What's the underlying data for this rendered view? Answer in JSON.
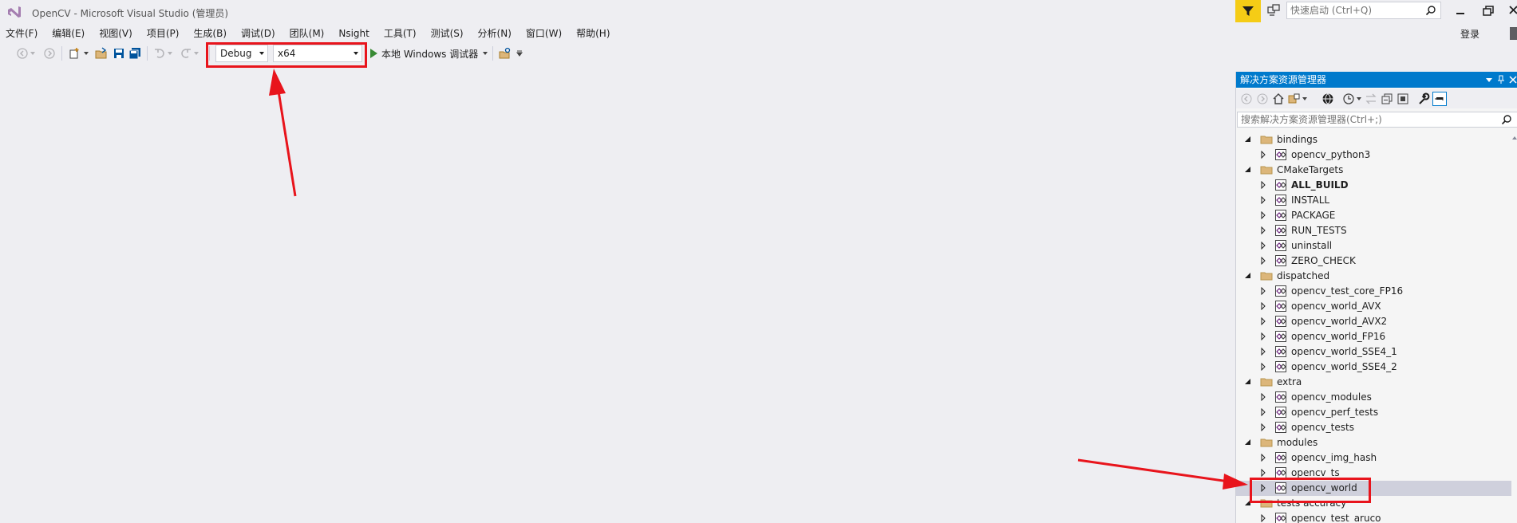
{
  "window": {
    "title": "OpenCV - Microsoft Visual Studio (管理员)",
    "quick_launch_placeholder": "快速启动 (Ctrl+Q)",
    "login_label": "登录"
  },
  "menu": {
    "items": [
      {
        "label": "文件(F)"
      },
      {
        "label": "编辑(E)"
      },
      {
        "label": "视图(V)"
      },
      {
        "label": "项目(P)"
      },
      {
        "label": "生成(B)"
      },
      {
        "label": "调试(D)"
      },
      {
        "label": "团队(M)"
      },
      {
        "label": "Nsight"
      },
      {
        "label": "工具(T)"
      },
      {
        "label": "测试(S)"
      },
      {
        "label": "分析(N)"
      },
      {
        "label": "窗口(W)"
      },
      {
        "label": "帮助(H)"
      }
    ]
  },
  "toolbar": {
    "configuration": "Debug",
    "platform": "x64",
    "debugger_label": "本地 Windows 调试器"
  },
  "solution_explorer": {
    "title": "解决方案资源管理器",
    "search_placeholder": "搜索解决方案资源管理器(Ctrl+;)",
    "tree": [
      {
        "label": "bindings",
        "kind": "folder",
        "level": 0,
        "expanded": true
      },
      {
        "label": "opencv_python3",
        "kind": "project",
        "level": 1
      },
      {
        "label": "CMakeTargets",
        "kind": "folder",
        "level": 0,
        "expanded": true
      },
      {
        "label": "ALL_BUILD",
        "kind": "project",
        "level": 1,
        "bold": true
      },
      {
        "label": "INSTALL",
        "kind": "project",
        "level": 1
      },
      {
        "label": "PACKAGE",
        "kind": "project",
        "level": 1
      },
      {
        "label": "RUN_TESTS",
        "kind": "project",
        "level": 1
      },
      {
        "label": "uninstall",
        "kind": "project",
        "level": 1
      },
      {
        "label": "ZERO_CHECK",
        "kind": "project",
        "level": 1
      },
      {
        "label": "dispatched",
        "kind": "folder",
        "level": 0,
        "expanded": true
      },
      {
        "label": "opencv_test_core_FP16",
        "kind": "project",
        "level": 1
      },
      {
        "label": "opencv_world_AVX",
        "kind": "project",
        "level": 1
      },
      {
        "label": "opencv_world_AVX2",
        "kind": "project",
        "level": 1
      },
      {
        "label": "opencv_world_FP16",
        "kind": "project",
        "level": 1
      },
      {
        "label": "opencv_world_SSE4_1",
        "kind": "project",
        "level": 1
      },
      {
        "label": "opencv_world_SSE4_2",
        "kind": "project",
        "level": 1
      },
      {
        "label": "extra",
        "kind": "folder",
        "level": 0,
        "expanded": true
      },
      {
        "label": "opencv_modules",
        "kind": "project",
        "level": 1
      },
      {
        "label": "opencv_perf_tests",
        "kind": "project",
        "level": 1
      },
      {
        "label": "opencv_tests",
        "kind": "project",
        "level": 1
      },
      {
        "label": "modules",
        "kind": "folder",
        "level": 0,
        "expanded": true
      },
      {
        "label": "opencv_img_hash",
        "kind": "project",
        "level": 1
      },
      {
        "label": "opencv_ts",
        "kind": "project",
        "level": 1
      },
      {
        "label": "opencv_world",
        "kind": "project",
        "level": 1,
        "selected": true
      },
      {
        "label": "tests accuracy",
        "kind": "folder",
        "level": 0,
        "expanded": true
      },
      {
        "label": "opencv_test_aruco",
        "kind": "project",
        "level": 1
      }
    ]
  },
  "colors": {
    "accent": "#007acc",
    "filter_button": "#f5cc16",
    "annotation_red": "#e8141c",
    "selection": "#cfd0dc",
    "background": "#eeeef2"
  }
}
